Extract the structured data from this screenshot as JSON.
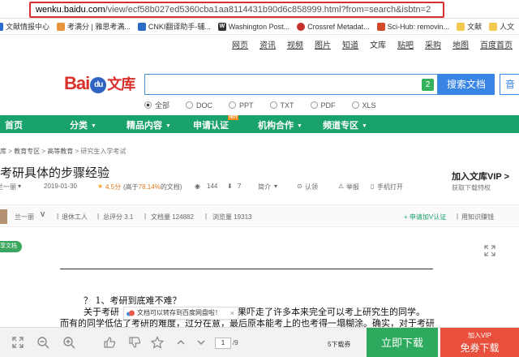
{
  "browser": {
    "url_host": "wenku.baidu.com",
    "url_path": "/view/ecf58b027ed5360cba1aa8114431b90d6c858999.html?from=search&isbtn=2"
  },
  "bookmarks": [
    {
      "label": "文献情报中心"
    },
    {
      "label": "考满分 | 雅思考满..."
    },
    {
      "label": "CNKI翻译助手-辅..."
    },
    {
      "label": "Washington Post..."
    },
    {
      "label": "Crossref Metadat..."
    },
    {
      "label": "Sci-Hub: removin..."
    },
    {
      "label": "文献"
    },
    {
      "label": "人文"
    }
  ],
  "topnav": [
    "网页",
    "资讯",
    "视频",
    "图片",
    "知道",
    "文库",
    "贴吧",
    "采购",
    "地图",
    "百度首页"
  ],
  "logo": {
    "part1": "Bai",
    "paw": "du",
    "part2": "文库"
  },
  "search": {
    "count": "2",
    "button": "搜索文档",
    "button2": "音"
  },
  "filters": [
    "全部",
    "DOC",
    "PPT",
    "TXT",
    "PDF",
    "XLS"
  ],
  "greennav": [
    {
      "label": "首页"
    },
    {
      "label": "分类"
    },
    {
      "label": "精品内容"
    },
    {
      "label": "申请认证",
      "badge": "HOT"
    },
    {
      "label": "机构合作"
    },
    {
      "label": "频道专区"
    }
  ],
  "breadcrumb": [
    "库",
    "教育专区",
    "高等教育",
    "研究生入学考试"
  ],
  "doc": {
    "title": "考研具体的步骤经验",
    "author_label": "兰一丽",
    "date": "2019-01-30",
    "rating": "4.5分",
    "rating_note_pre": "(高于",
    "rating_pct": "78.14%",
    "rating_note_post": "的文档)",
    "views": "144",
    "downloads": "7",
    "intro": "简介",
    "certified": "认领",
    "report": "举报",
    "mobile": "手机打开"
  },
  "vip_promo": {
    "title": "加入文库VIP >",
    "sub": "获取下载特权"
  },
  "uploader": {
    "name": "兰一丽",
    "badge": "V",
    "role": "退休工人",
    "score": "总评分 3.1",
    "docs": "文档量 124882",
    "views": "浏览量 19313",
    "apply": "+ 申请加V认证",
    "copyright": "用知识赚钱"
  },
  "share_tag": "享文档",
  "content": {
    "line1": "？ 1、考研到底难不难？",
    "line2_a": "关于考研",
    "line2_b": "果吓走了许多本来完全可以考上研究生的同学。",
    "line3": "而有的同学低估了考研的难度，过分在意，最后原本能考上的也考得一塌糊涂。确实，对于考研"
  },
  "tooltip": "文档可以转存到百度网盘啦！",
  "bottom": {
    "page_current": "1",
    "page_total": "/9",
    "price": "5下载券",
    "download": "立即下载",
    "vip_line1": "加入VIP",
    "vip_line2": "免券下载"
  },
  "colors": {
    "green": "#1aa26c",
    "blue": "#3985e5",
    "red": "#d9302b"
  }
}
